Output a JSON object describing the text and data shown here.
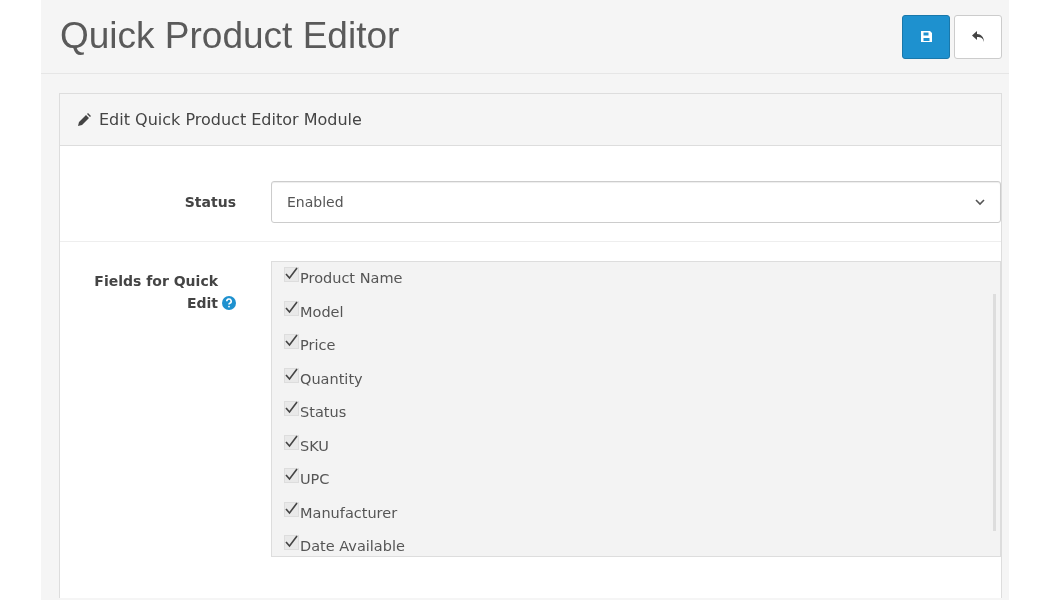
{
  "page_title": "Quick Product Editor",
  "header_buttons": [
    {
      "kind": "save"
    },
    {
      "kind": "back"
    }
  ],
  "panel": {
    "title": "Edit Quick Product Editor Module"
  },
  "status_field": {
    "label": "Status",
    "value": "Enabled"
  },
  "fields_field": {
    "label": "Fields for Quick Edit",
    "options": [
      {
        "label": "Product Name",
        "checked": true
      },
      {
        "label": "Model",
        "checked": true
      },
      {
        "label": "Price",
        "checked": true
      },
      {
        "label": "Quantity",
        "checked": true
      },
      {
        "label": "Status",
        "checked": true
      },
      {
        "label": "SKU",
        "checked": true
      },
      {
        "label": "UPC",
        "checked": true
      },
      {
        "label": "Manufacturer",
        "checked": true
      },
      {
        "label": "Date Available",
        "checked": true
      }
    ]
  }
}
